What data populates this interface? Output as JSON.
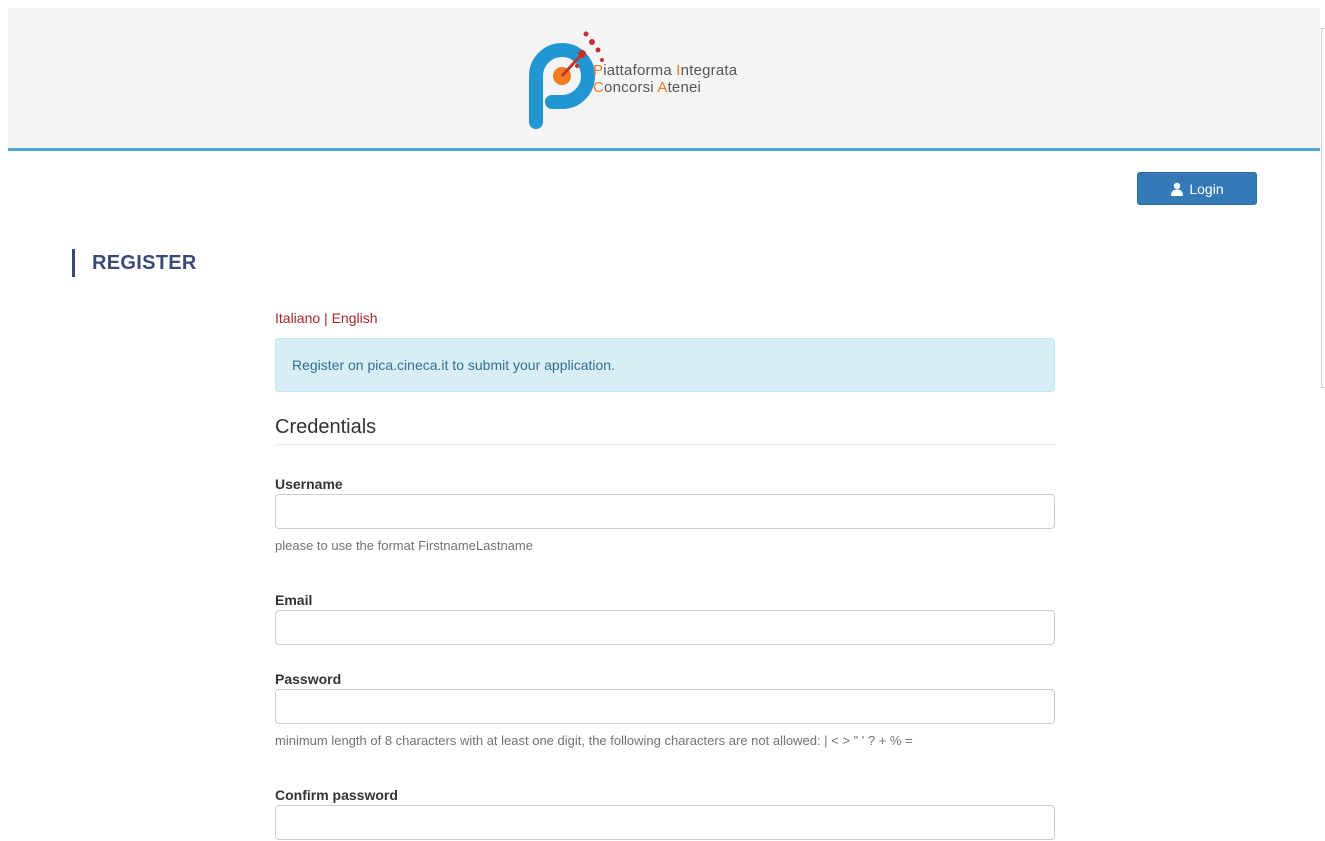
{
  "header": {
    "logo_line1": {
      "first_letter": "P",
      "rest1": "iattaforma ",
      "letter2": "I",
      "rest2": "ntegrata"
    },
    "logo_line2": {
      "first_letter": "C",
      "rest1": "oncorsi ",
      "letter2": "A",
      "rest2": "tenei"
    }
  },
  "toolbar": {
    "login_label": "Login"
  },
  "page": {
    "title": "REGISTER"
  },
  "language": {
    "italian": "Italiano",
    "separator": "|",
    "english": "English"
  },
  "info": {
    "message": "Register on pica.cineca.it to submit your application."
  },
  "section": {
    "title": "Credentials"
  },
  "form": {
    "username": {
      "label": "Username",
      "value": "",
      "help": "please to use the format FirstnameLastname"
    },
    "email": {
      "label": "Email",
      "value": ""
    },
    "password": {
      "label": "Password",
      "value": "",
      "help": "minimum length of 8 characters with at least one digit, the following characters are not allowed: | < > \" ' ? + % ="
    },
    "confirm_password": {
      "label": "Confirm password",
      "value": ""
    }
  },
  "colors": {
    "accent_blue": "#337ab7",
    "header_line": "#4aa8d8",
    "title": "#3b4a74",
    "link_red": "#a8262b",
    "logo_orange": "#f07b22",
    "info_bg": "#d9edf7"
  },
  "icons": {
    "login": "user-icon",
    "logo": "pica-logo-icon"
  }
}
